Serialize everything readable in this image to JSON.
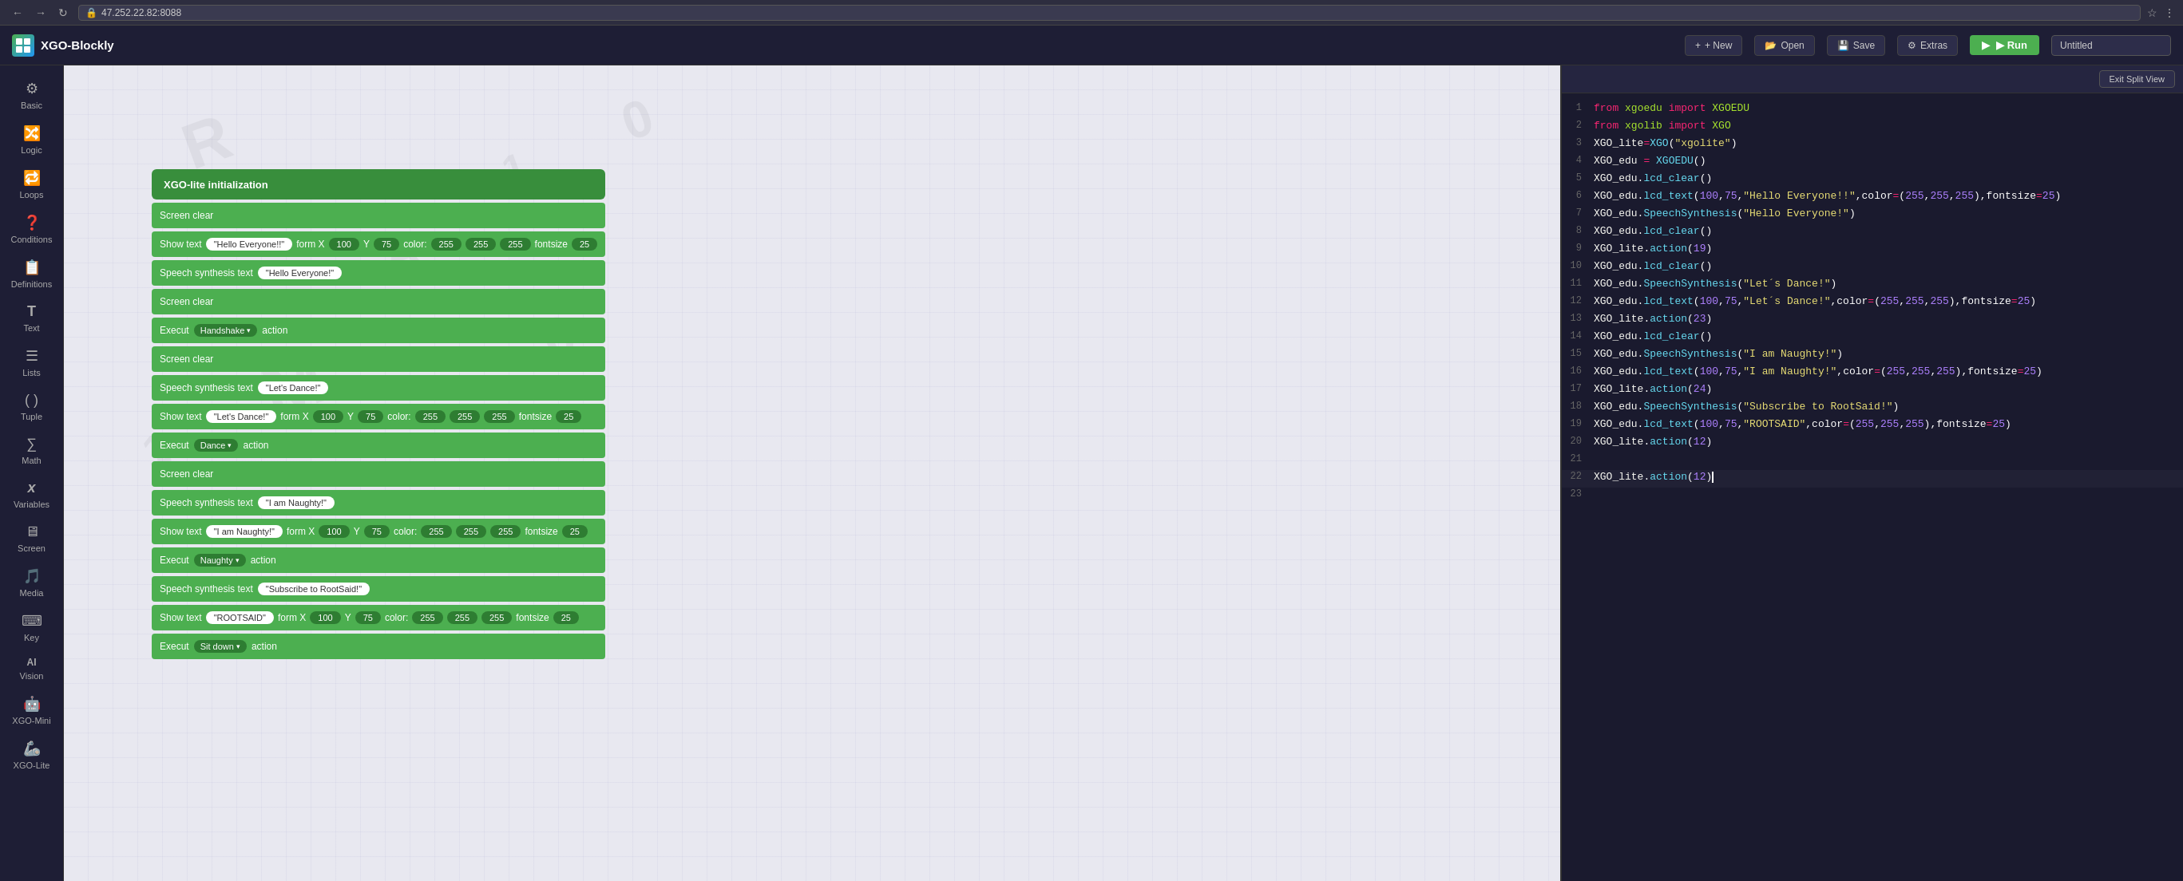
{
  "browser": {
    "url": "47.252.22.82:8088",
    "back": "←",
    "forward": "→",
    "refresh": "↻"
  },
  "app": {
    "title": "XGO-Blockly",
    "logo_text": "XGO",
    "title_input": "Untitled"
  },
  "header_buttons": {
    "new_label": "+ New",
    "open_label": "Open",
    "save_label": "Save",
    "extras_label": "Extras",
    "run_label": "▶ Run",
    "split_view_label": "Exit Split View"
  },
  "sidebar": {
    "items": [
      {
        "id": "basic",
        "label": "Basic",
        "icon": "⚙"
      },
      {
        "id": "logic",
        "label": "Logic",
        "icon": "🔀"
      },
      {
        "id": "loops",
        "label": "Loops",
        "icon": "🔁"
      },
      {
        "id": "conditions",
        "label": "Conditions",
        "icon": "❓"
      },
      {
        "id": "definitions",
        "label": "Definitions",
        "icon": "📋"
      },
      {
        "id": "text",
        "label": "Text",
        "icon": "T"
      },
      {
        "id": "lists",
        "label": "Lists",
        "icon": "☰"
      },
      {
        "id": "tuple",
        "label": "Tuple",
        "icon": "( )"
      },
      {
        "id": "math",
        "label": "Math",
        "icon": "∑"
      },
      {
        "id": "variables",
        "label": "Variables",
        "icon": "x"
      },
      {
        "id": "screen",
        "label": "Screen",
        "icon": "🖥"
      },
      {
        "id": "media",
        "label": "Media",
        "icon": "🎵"
      },
      {
        "id": "key",
        "label": "Key",
        "icon": "⌨"
      },
      {
        "id": "vision",
        "label": "Vision",
        "icon": "AI"
      },
      {
        "id": "xgo_mini",
        "label": "XGO-Mini",
        "icon": "🤖"
      },
      {
        "id": "xgo_lite",
        "label": "XGO-Lite",
        "icon": "🦾"
      }
    ]
  },
  "blocks": [
    {
      "type": "init",
      "label": "XGO-lite initialization"
    },
    {
      "type": "screen_clear",
      "label": "Screen clear"
    },
    {
      "type": "show_text",
      "label": "Show text",
      "text": "\"Hello Everyone!!\"",
      "form": "X",
      "x": "100",
      "y_label": "Y",
      "y": "75",
      "color_label": "color:",
      "c1": "255",
      "c2": "255",
      "c3": "255",
      "fontsize_label": "fontsize",
      "fontsize": "25"
    },
    {
      "type": "speech",
      "label": "Speech synthesis text",
      "text": "\"Hello Everyone!\""
    },
    {
      "type": "screen_clear2",
      "label": "Screen clear"
    },
    {
      "type": "execut1",
      "label": "Execut",
      "action_name": "Handshake",
      "action_label": "action"
    },
    {
      "type": "screen_clear3",
      "label": "Screen clear"
    },
    {
      "type": "speech2",
      "label": "Speech synthesis text",
      "text": "\"Let's Dance!\""
    },
    {
      "type": "show_text2",
      "label": "Show text",
      "text": "\"Let's Dance!\"",
      "form": "X",
      "x": "100",
      "y_label": "Y",
      "y": "75",
      "color_label": "color:",
      "c1": "255",
      "c2": "255",
      "c3": "255",
      "fontsize_label": "fontsize",
      "fontsize": "25"
    },
    {
      "type": "execut2",
      "label": "Execut",
      "action_name": "Dance",
      "action_label": "action"
    },
    {
      "type": "screen_clear4",
      "label": "Screen clear"
    },
    {
      "type": "speech3",
      "label": "Speech synthesis text",
      "text": "\"I am Naughty!\""
    },
    {
      "type": "show_text3",
      "label": "Show text",
      "text": "\"I am Naughty!\"",
      "form": "X",
      "x": "100",
      "y_label": "Y",
      "y": "75",
      "color_label": "color:",
      "c1": "255",
      "c2": "255",
      "c3": "255",
      "fontsize_label": "fontsize",
      "fontsize": "25"
    },
    {
      "type": "execut3",
      "label": "Execut",
      "action_name": "Naughty",
      "action_label": "action"
    },
    {
      "type": "speech4",
      "label": "Speech synthesis text",
      "text": "\"Subscribe to RootSaid!\""
    },
    {
      "type": "show_text4",
      "label": "Show text",
      "text": "\"ROOTSAID\"",
      "form": "X",
      "x": "100",
      "y_label": "Y",
      "y": "75",
      "color_label": "color:",
      "c1": "255",
      "c2": "255",
      "c3": "255",
      "fontsize_label": "fontsize",
      "fontsize": "25"
    },
    {
      "type": "execut4",
      "label": "Execut",
      "action_name": "Sit down",
      "action_label": "action"
    }
  ],
  "code": {
    "lines": [
      {
        "n": 1,
        "text": "from xgoedu import XGOEDU"
      },
      {
        "n": 2,
        "text": "from xgolib import XGO"
      },
      {
        "n": 3,
        "text": "XGO_lite=XGO(\"xgolite\")"
      },
      {
        "n": 4,
        "text": "XGO_edu = XGOEDU()"
      },
      {
        "n": 5,
        "text": "XGO_edu.lcd_clear()"
      },
      {
        "n": 6,
        "text": "XGO_edu.lcd_text(100,75,\"Hello Everyone!!\",color=(255,255,255),fontsize=25)"
      },
      {
        "n": 7,
        "text": "XGO_edu.SpeechSynthesis(\"Hello Everyone!\")"
      },
      {
        "n": 8,
        "text": "XGO_edu.lcd_clear()"
      },
      {
        "n": 9,
        "text": "XGO_lite.action(19)"
      },
      {
        "n": 10,
        "text": "XGO_edu.lcd_clear()"
      },
      {
        "n": 11,
        "text": "XGO_edu.SpeechSynthesis(\"Let´s Dance!\")"
      },
      {
        "n": 12,
        "text": "XGO_edu.lcd_text(100,75,\"Let´s Dance!\",color=(255,255,255),fontsize=25)"
      },
      {
        "n": 13,
        "text": "XGO_lite.action(23)"
      },
      {
        "n": 14,
        "text": "XGO_edu.lcd_clear()"
      },
      {
        "n": 15,
        "text": "XGO_edu.SpeechSynthesis(\"I am Naughty!\")"
      },
      {
        "n": 16,
        "text": "XGO_edu.lcd_text(100,75,\"I am Naughty!\",color=(255,255,255),fontsize=25)"
      },
      {
        "n": 17,
        "text": "XGO_lite.action(24)"
      },
      {
        "n": 18,
        "text": "XGO_edu.SpeechSynthesis(\"Subscribe to RootSaid!\")"
      },
      {
        "n": 19,
        "text": "XGO_edu.lcd_text(100,75,\"ROOTSAID\",color=(255,255,255),fontsize=25)"
      },
      {
        "n": 20,
        "text": "XGO_lite.action(12)"
      },
      {
        "n": 21,
        "text": ""
      },
      {
        "n": 22,
        "text": "XGO_lite.action(12)"
      },
      {
        "n": 23,
        "text": ""
      }
    ]
  },
  "colors": {
    "block_green": "#4CAF50",
    "block_dark_green": "#388E3C",
    "sidebar_bg": "#1e1e35",
    "code_bg": "#1a1a2e",
    "header_bg": "#1e1e35"
  }
}
